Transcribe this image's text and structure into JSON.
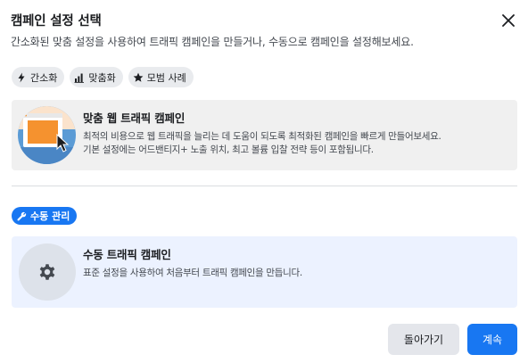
{
  "dialog": {
    "title": "캠페인 설정 선택",
    "subtitle": "간소화된 맞춤 설정을 사용하여 트래픽 캠페인을 만들거나, 수동으로 캠페인을 설정해보세요."
  },
  "chips": [
    {
      "label": "간소화",
      "icon": "lightning-icon"
    },
    {
      "label": "맞춤화",
      "icon": "bar-chart-icon"
    },
    {
      "label": "모범 사례",
      "icon": "star-icon"
    }
  ],
  "smart_card": {
    "title": "맞춤 웹 트래픽 캠페인",
    "desc_line1": "최적의 비용으로 웹 트래픽을 늘리는 데 도움이 되도록 최적화된 캠페인을 빠르게 만들어보세요.",
    "desc_line2": "기본 설정에는 어드밴티지+ 노출 위치, 최고 볼륨 입찰 전략 등이 포함됩니다."
  },
  "manual_badge": {
    "label": "수동 관리",
    "icon": "wrench-icon"
  },
  "manual_card": {
    "title": "수동 트래픽 캠페인",
    "desc": "표준 설정을 사용하여 처음부터 트래픽 캠페인을 만듭니다.",
    "icon": "gear-icon"
  },
  "footer": {
    "back_label": "돌아가기",
    "next_label": "계속"
  },
  "colors": {
    "accent": "#1877f2",
    "card_smart_bg": "#f0f0f0",
    "card_manual_bg": "#ecf2ff",
    "illustration_orange": "#f5922f",
    "illustration_blue": "#5b9bd5"
  }
}
